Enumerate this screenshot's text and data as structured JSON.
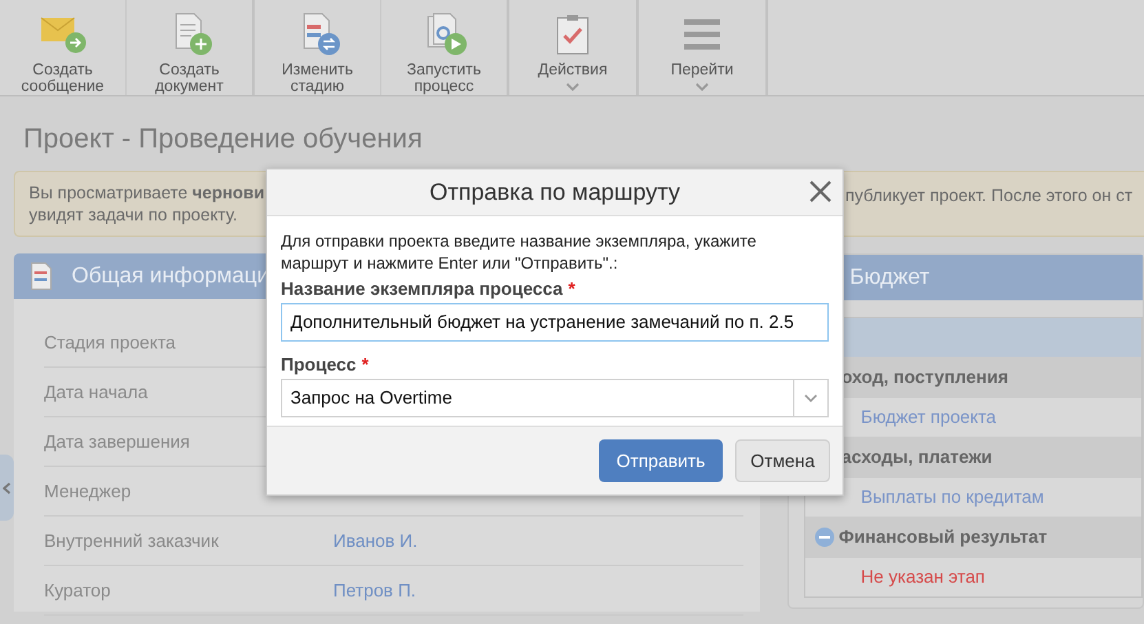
{
  "toolbar": {
    "buttons": [
      {
        "label": "Создать сообщение",
        "dropdown": false
      },
      {
        "label": "Создать документ",
        "dropdown": false
      },
      {
        "label": "Изменить стадию",
        "dropdown": false
      },
      {
        "label": "Запустить процесс",
        "dropdown": false
      },
      {
        "label": "Действия",
        "dropdown": true
      },
      {
        "label": "Перейти",
        "dropdown": true
      }
    ]
  },
  "page_title": "Проект - Проведение обучения",
  "notice": {
    "left_lines": [
      "Вы просматриваете **чернови**",
      "увидят задачи по проекту."
    ],
    "right_text": "публикует проект. После этого он ст"
  },
  "general_panel": {
    "title": "Общая информаци",
    "fields": [
      {
        "label": "Стадия проекта"
      },
      {
        "label": "Дата начала"
      },
      {
        "label": "Дата завершения"
      },
      {
        "label": "Менеджер"
      },
      {
        "label": "Внутренний заказчик",
        "value": "Иванов И."
      },
      {
        "label": "Куратор",
        "value": "Петров П."
      }
    ]
  },
  "budget_panel": {
    "title": "Бюджет",
    "rows": [
      {
        "kind": "header"
      },
      {
        "kind": "group",
        "text": "оход, поступления"
      },
      {
        "kind": "item",
        "text": "Бюджет проекта",
        "error": false
      },
      {
        "kind": "group",
        "text": "асходы, платежи"
      },
      {
        "kind": "item",
        "text": "Выплаты по кредитам",
        "error": false
      },
      {
        "kind": "group",
        "text": "Финансовый результат",
        "expanded": true
      },
      {
        "kind": "item",
        "text": "Не указан этап",
        "error": true
      }
    ]
  },
  "dialog": {
    "title": "Отправка по маршруту",
    "intro": "Для отправки проекта введите название экземпляра, укажите маршрут и нажмите Enter или \"Отправить\".:",
    "name_label": "Название экземпляра процесса",
    "name_required_mark": "*",
    "name_value": "Дополнительный бюджет на устранение замечаний по п. 2.5",
    "process_label": "Процесс",
    "process_required_mark": "*",
    "process_value": "Запрос на Overtime",
    "buttons": [
      {
        "label": "Отправить",
        "primary": true
      },
      {
        "label": "Отмена",
        "primary": false
      }
    ]
  }
}
